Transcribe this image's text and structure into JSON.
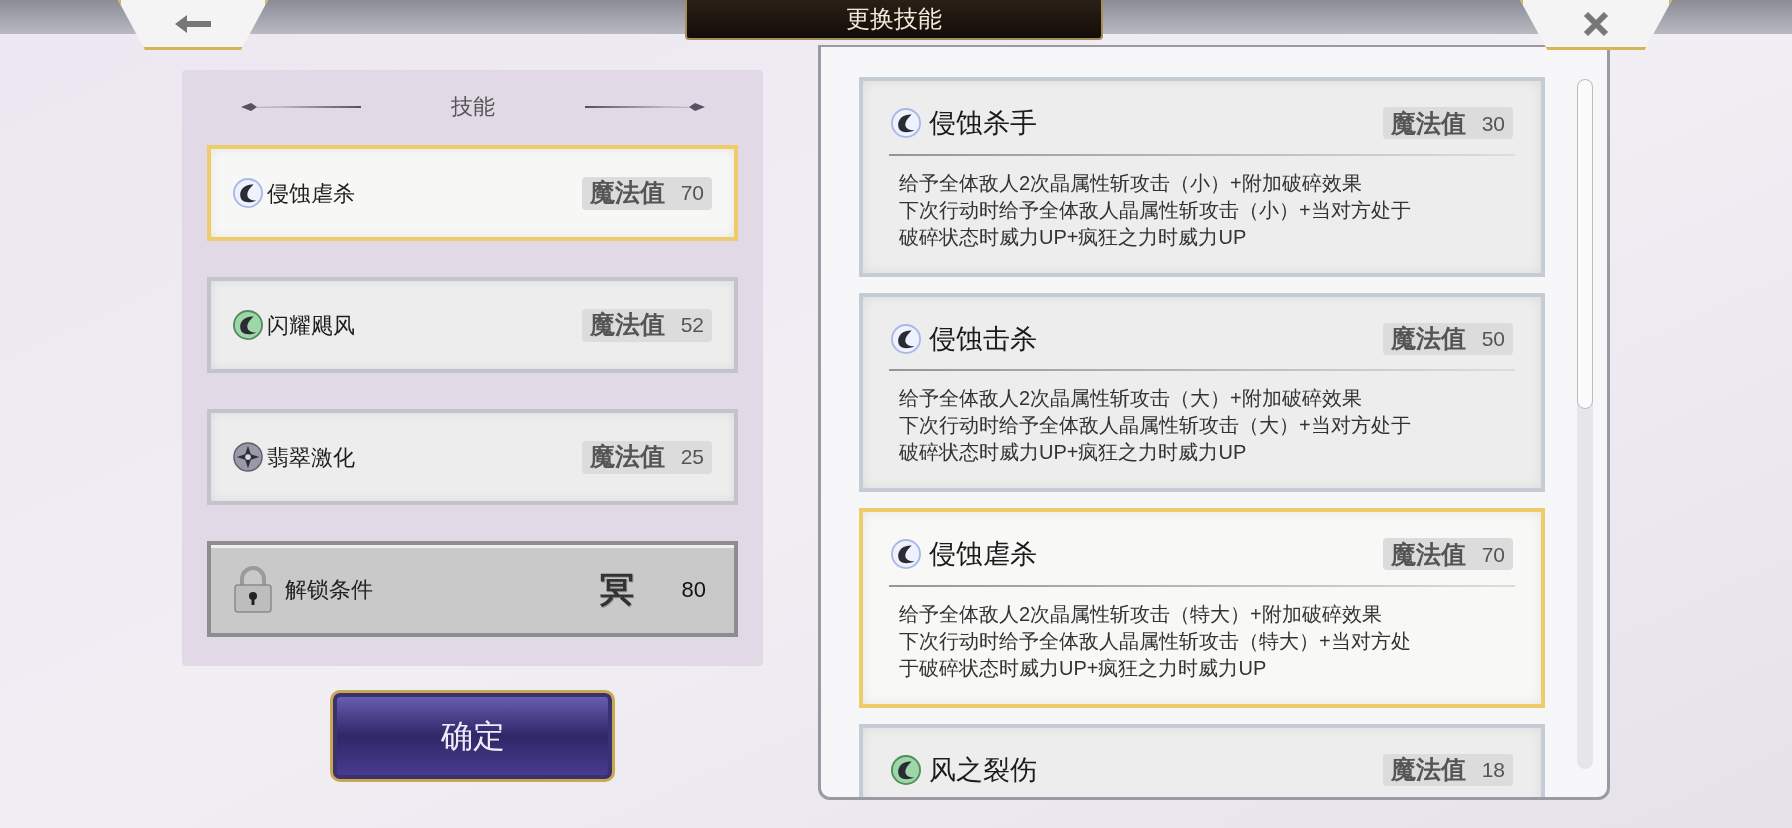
{
  "top_bar": {
    "title": "更换技能"
  },
  "equipped": {
    "heading": "技能",
    "skills": [
      {
        "kind": "crystal",
        "name": "侵蚀虐杀",
        "cost_label": "魔法值",
        "cost": "70",
        "selected": true
      },
      {
        "kind": "wind",
        "name": "闪耀飓风",
        "cost_label": "魔法值",
        "cost": "52",
        "selected": false
      },
      {
        "kind": "star",
        "name": "翡翠激化",
        "cost_label": "魔法值",
        "cost": "25",
        "selected": false
      },
      {
        "kind": "locked",
        "name": "解锁条件",
        "cost_label": "冥",
        "cost": "80",
        "selected": false
      }
    ]
  },
  "confirm_button": "确定",
  "available": [
    {
      "kind": "crystal",
      "name": "侵蚀杀手",
      "cost_label": "魔法值",
      "cost": "30",
      "selected": false,
      "lines": [
        "给予全体敌人2次晶属性斩攻击（小）+附加破碎效果",
        "下次行动时给予全体敌人晶属性斩攻击（小）+当对方处于",
        "破碎状态时威力UP+疯狂之力时威力UP"
      ]
    },
    {
      "kind": "crystal",
      "name": "侵蚀击杀",
      "cost_label": "魔法值",
      "cost": "50",
      "selected": false,
      "lines": [
        "给予全体敌人2次晶属性斩攻击（大）+附加破碎效果",
        "下次行动时给予全体敌人晶属性斩攻击（大）+当对方处于",
        "破碎状态时威力UP+疯狂之力时威力UP"
      ]
    },
    {
      "kind": "crystal",
      "name": "侵蚀虐杀",
      "cost_label": "魔法值",
      "cost": "70",
      "selected": true,
      "lines": [
        "给予全体敌人2次晶属性斩攻击（特大）+附加破碎效果",
        "下次行动时给予全体敌人晶属性斩攻击（特大）+当对方处",
        "于破碎状态时威力UP+疯狂之力时威力UP"
      ]
    },
    {
      "kind": "wind",
      "name": "风之裂伤",
      "cost_label": "魔法值",
      "cost": "18",
      "selected": false
    }
  ]
}
